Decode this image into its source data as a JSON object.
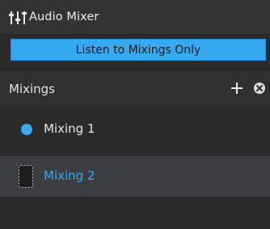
{
  "window": {
    "title": "Audio Mixer",
    "title_icon": "mixer-sliders-icon"
  },
  "listen_button": {
    "label": "Listen to Mixings Only",
    "color": "#35a9f2"
  },
  "mixings": {
    "header": "Mixings",
    "add_icon": "plus-icon",
    "remove_icon": "close-circle-icon",
    "items": [
      {
        "label": "Mixing 1",
        "state": "active",
        "indicator": "dot-icon"
      },
      {
        "label": "Mixing 2",
        "state": "selected",
        "indicator": "dashed-placeholder-icon"
      }
    ]
  },
  "colors": {
    "accent": "#35a9f2",
    "background": "#2b2b2b",
    "selected_row": "#3b3f44"
  }
}
